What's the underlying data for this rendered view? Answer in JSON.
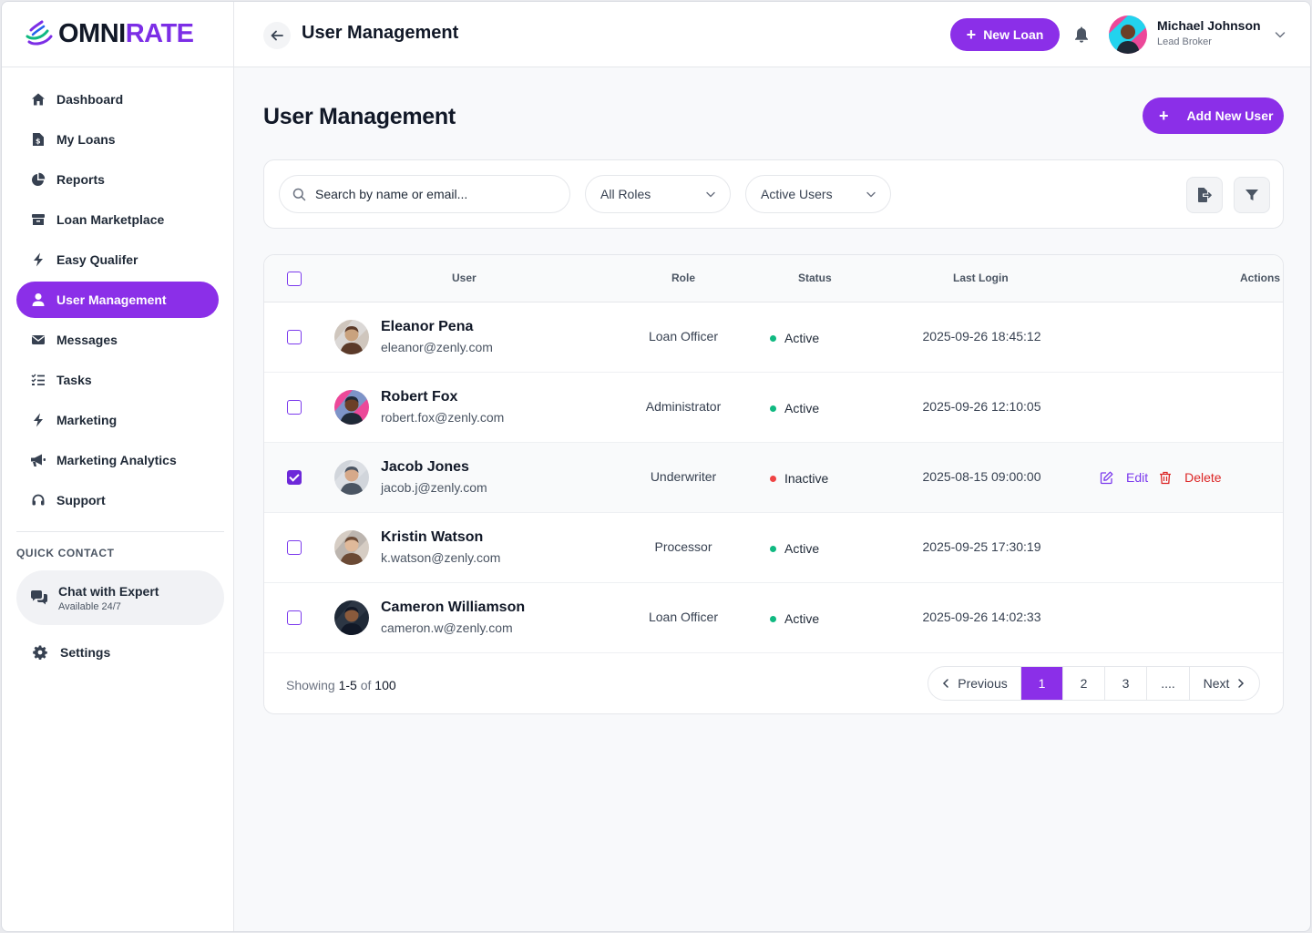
{
  "brand": {
    "part1": "OMNI",
    "part2": "RATE"
  },
  "sidebar": {
    "items": [
      {
        "label": "Dashboard",
        "icon": "home-icon"
      },
      {
        "label": "My Loans",
        "icon": "document-dollar-icon"
      },
      {
        "label": "Reports",
        "icon": "pie-chart-icon"
      },
      {
        "label": "Loan Marketplace",
        "icon": "archive-icon"
      },
      {
        "label": "Easy Qualifer",
        "icon": "bolt-icon"
      },
      {
        "label": "User Management",
        "icon": "user-icon",
        "active": true
      },
      {
        "label": "Messages",
        "icon": "envelope-icon"
      },
      {
        "label": "Tasks",
        "icon": "list-check-icon"
      },
      {
        "label": "Marketing",
        "icon": "bolt-icon"
      },
      {
        "label": "Marketing Analytics",
        "icon": "megaphone-icon"
      },
      {
        "label": "Support",
        "icon": "headset-icon"
      }
    ],
    "quick_contact_title": "QUICK CONTACT",
    "chat_title": "Chat with Expert",
    "chat_subtitle": "Available 24/7",
    "settings_label": "Settings"
  },
  "header": {
    "title": "User Management",
    "new_loan_label": "New Loan",
    "user_name": "Michael Johnson",
    "user_role": "Lead Broker"
  },
  "main": {
    "title": "User Management",
    "add_user_label": "Add New User",
    "search_placeholder": "Search by name or email...",
    "role_filter": "All Roles",
    "status_filter": "Active Users"
  },
  "table": {
    "columns": {
      "user": "User",
      "role": "Role",
      "status": "Status",
      "last_login": "Last Login",
      "actions": "Actions"
    },
    "rows": [
      {
        "name": "Eleanor Pena",
        "email": "eleanor@zenly.com",
        "role": "Loan Officer",
        "status": "Active",
        "last_login": "2025-09-26 18:45:12",
        "checked": false
      },
      {
        "name": "Robert Fox",
        "email": "robert.fox@zenly.com",
        "role": "Administrator",
        "status": "Active",
        "last_login": "2025-09-26 12:10:05",
        "checked": false
      },
      {
        "name": "Jacob Jones",
        "email": "jacob.j@zenly.com",
        "role": "Underwriter",
        "status": "Inactive",
        "last_login": "2025-08-15 09:00:00",
        "checked": true
      },
      {
        "name": "Kristin Watson",
        "email": "k.watson@zenly.com",
        "role": "Processor",
        "status": "Active",
        "last_login": "2025-09-25 17:30:19",
        "checked": false
      },
      {
        "name": "Cameron Williamson",
        "email": "cameron.w@zenly.com",
        "role": "Loan Officer",
        "status": "Active",
        "last_login": "2025-09-26 14:02:33",
        "checked": false
      }
    ],
    "edit_label": "Edit",
    "delete_label": "Delete"
  },
  "footer": {
    "showing_prefix": "Showing ",
    "showing_range": "1-5",
    "showing_of": " of ",
    "showing_total": "100",
    "prev_label": "Previous",
    "pages": [
      "1",
      "2",
      "3",
      "...."
    ],
    "next_label": "Next"
  },
  "colors": {
    "accent": "#8b2fe8",
    "active_status": "#10b981",
    "inactive_status": "#ef4444",
    "delete": "#dc2626"
  }
}
